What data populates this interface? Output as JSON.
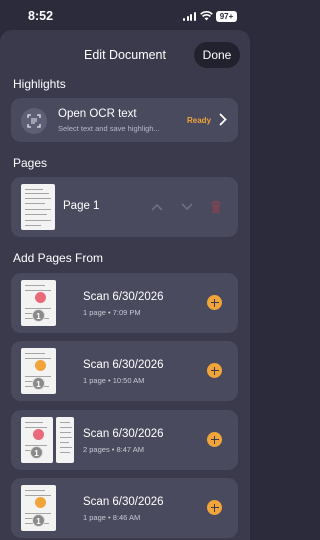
{
  "status": {
    "time": "8:52",
    "battery": "97+"
  },
  "header": {
    "title": "Edit Document",
    "done_label": "Done"
  },
  "sections": {
    "highlights": "Highlights",
    "pages": "Pages",
    "add_pages": "Add Pages From"
  },
  "highlights": {
    "icon": "text-scan-icon",
    "ocr_title": "Open OCR text",
    "ocr_subtitle": "Select text and save highligh...",
    "status": "Ready"
  },
  "pages": [
    {
      "label": "Page 1"
    }
  ],
  "scans": [
    {
      "title": "Scan 6/30/2026",
      "meta": "1 page • 7:09 PM",
      "count": "1"
    },
    {
      "title": "Scan 6/30/2026",
      "meta": "1 page • 10:50 AM",
      "count": "1"
    },
    {
      "title": "Scan 6/30/2026",
      "meta": "2 pages • 8:47 AM",
      "count": "1"
    },
    {
      "title": "Scan 6/30/2026",
      "meta": "1 page • 8:46 AM",
      "count": "1"
    }
  ],
  "colors": {
    "accent": "#f0a43a",
    "background": "#2b2b3c",
    "card": "#4a4a5e",
    "delete": "#7a4553"
  }
}
